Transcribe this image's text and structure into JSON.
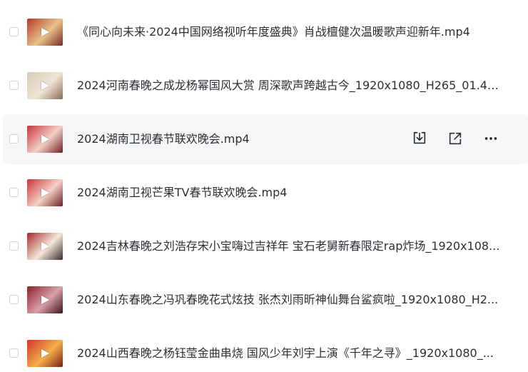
{
  "files": [
    {
      "name": "《同心向未来·2024中国网络视听年度盛典》肖战檀健次温暖歌声迎新年.mp4",
      "thumb_colors": [
        "#b33a2c",
        "#e8c28a",
        "#7a2a22"
      ]
    },
    {
      "name": "2024河南春晚之成龙杨幂国风大赏 周深歌声跨越古今_1920x1080_H265_01.42...",
      "thumb_colors": [
        "#d9c9b5",
        "#f0e4d6",
        "#8c6b55"
      ]
    },
    {
      "name": "2024湖南卫视春节联欢晚会.mp4",
      "thumb_colors": [
        "#c8343a",
        "#f2d0c4",
        "#6e1f24"
      ]
    },
    {
      "name": "2024湖南卫视芒果TV春节联欢晚会.mp4",
      "thumb_colors": [
        "#c8343a",
        "#f2d0c4",
        "#6e1f24"
      ]
    },
    {
      "name": "2024吉林春晚之刘浩存宋小宝嗨过吉祥年 宝石老舅新春限定rap炸场_1920x108...",
      "thumb_colors": [
        "#a52a2a",
        "#f4e8d8",
        "#3a2a2a"
      ]
    },
    {
      "name": "2024山东春晚之冯巩春晚花式炫技 张杰刘雨昕神仙舞台鲨疯啦_1920x1080_H2...",
      "thumb_colors": [
        "#8e1e2a",
        "#d9a0a8",
        "#3b1418"
      ]
    },
    {
      "name": "2024山西春晚之杨钰莹金曲串烧 国风少年刘宇上演《千年之寻》_1920x1080_...",
      "thumb_colors": [
        "#d2312a",
        "#f4b04a",
        "#7a1c18"
      ]
    }
  ],
  "hovered_index": 2,
  "row_actions": {
    "download_icon": "download-icon",
    "share_icon": "share-icon",
    "more_icon": "more-icon"
  }
}
